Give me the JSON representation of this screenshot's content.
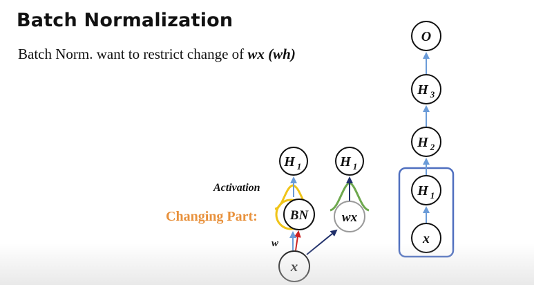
{
  "title": "Batch Normalization",
  "subtitle": {
    "prefix": "Batch Norm. want to restrict change of ",
    "term1": "wx",
    "term2": "(wh)"
  },
  "left_diagram": {
    "top_node": "H",
    "top_node_sub": "1",
    "bn_node": "BN",
    "bottom_node": "x",
    "activation_label": "Activation",
    "changing_label": "Changing Part:",
    "weight_label": "w"
  },
  "middle_diagram": {
    "top_node": "H",
    "top_node_sub": "1",
    "wx_node": "wx"
  },
  "right_stack": {
    "nodes": [
      {
        "label": "O",
        "sub": ""
      },
      {
        "label": "H",
        "sub": "3"
      },
      {
        "label": "H",
        "sub": "2"
      },
      {
        "label": "H",
        "sub": "1"
      },
      {
        "label": "x",
        "sub": ""
      }
    ]
  },
  "colors": {
    "arrow_blue": "#6a9bd8",
    "highlight_box": "#4f6fbf",
    "activation_curve": "#f0c419",
    "changing_text": "#e8913c",
    "wx_curve": "#6ea84e",
    "wx_circle": "#9a9a9a",
    "red_arrow": "#cc2222",
    "navy_arrow": "#1f2f6a"
  }
}
